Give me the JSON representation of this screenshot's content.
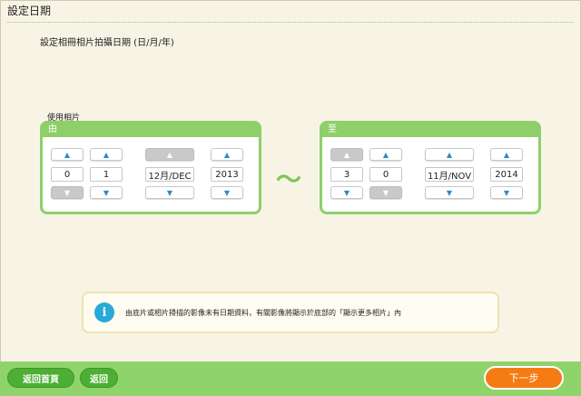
{
  "window_title": "設定日期",
  "instruction": "設定相冊相片拍攝日期 (日/月/年)",
  "photo_label": "使用相片",
  "from_panel": {
    "heading": "由",
    "fields": [
      {
        "value": "0",
        "up_enabled": true,
        "down_enabled": false
      },
      {
        "value": "1",
        "up_enabled": true,
        "down_enabled": true
      },
      {
        "value": "12月/DEC",
        "up_enabled": false,
        "down_enabled": true
      },
      {
        "value": "2013",
        "up_enabled": true,
        "down_enabled": true
      }
    ]
  },
  "separator": "～",
  "to_panel": {
    "heading": "至",
    "fields": [
      {
        "value": "3",
        "up_enabled": false,
        "down_enabled": true
      },
      {
        "value": "0",
        "up_enabled": true,
        "down_enabled": false
      },
      {
        "value": "11月/NOV",
        "up_enabled": true,
        "down_enabled": true
      },
      {
        "value": "2014",
        "up_enabled": true,
        "down_enabled": true
      }
    ]
  },
  "arrows": {
    "up": "▲",
    "down": "▼"
  },
  "info": {
    "icon": "i",
    "text": "由底片或相片掃描的影像未有日期資料，有關影像將顯示於底部的「顯示更多相片」內"
  },
  "footer": {
    "home_label": "返回首頁",
    "back_label": "返回",
    "next_label": "下一步"
  },
  "colors": {
    "panel_green": "#8fcf6a",
    "footer_green": "#8fd46a",
    "button_green": "#4caf34",
    "next_orange": "#f57b14",
    "info_blue": "#27a9d9"
  }
}
